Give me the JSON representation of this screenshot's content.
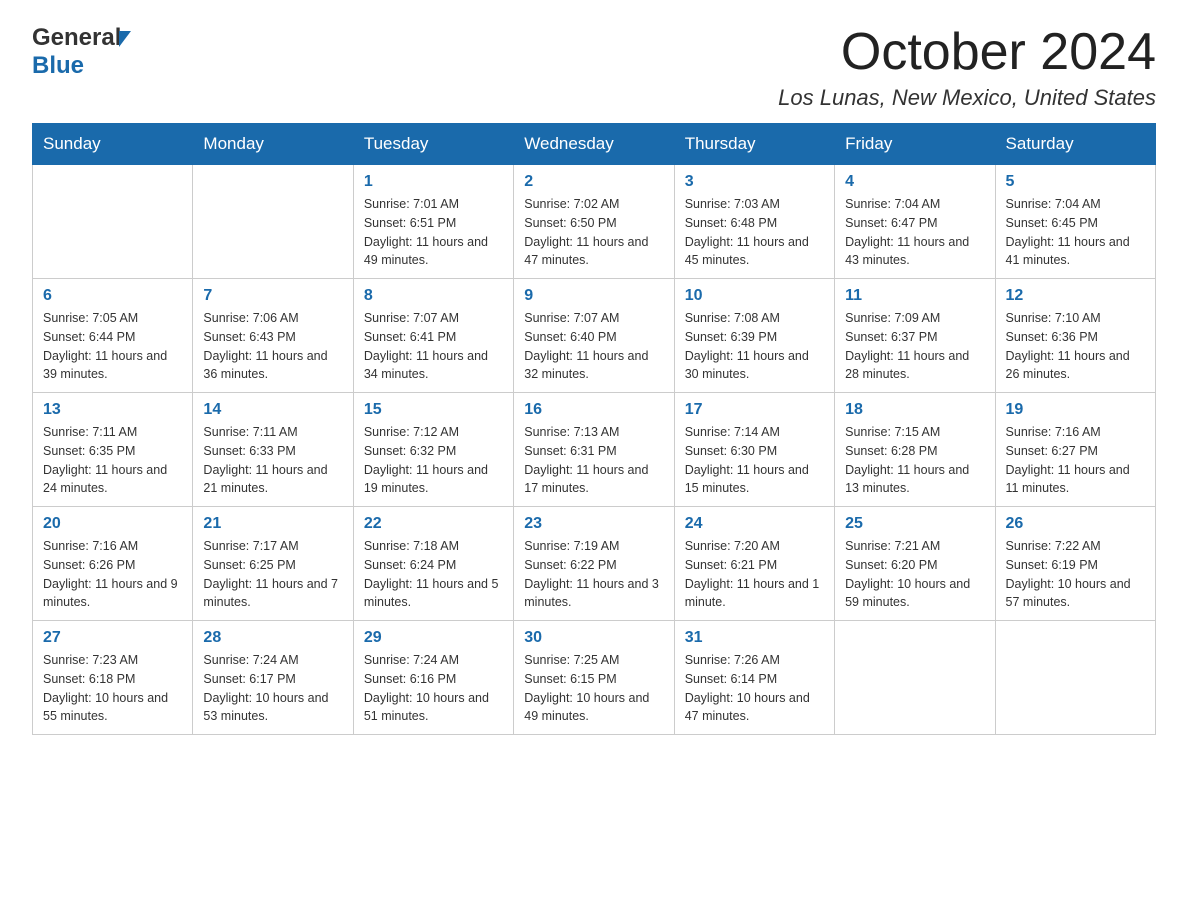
{
  "logo": {
    "general": "General",
    "triangle": "▶",
    "blue": "Blue"
  },
  "header": {
    "month": "October 2024",
    "location": "Los Lunas, New Mexico, United States"
  },
  "days_of_week": [
    "Sunday",
    "Monday",
    "Tuesday",
    "Wednesday",
    "Thursday",
    "Friday",
    "Saturday"
  ],
  "weeks": [
    [
      {
        "day": "",
        "info": ""
      },
      {
        "day": "",
        "info": ""
      },
      {
        "day": "1",
        "info": "Sunrise: 7:01 AM\nSunset: 6:51 PM\nDaylight: 11 hours\nand 49 minutes."
      },
      {
        "day": "2",
        "info": "Sunrise: 7:02 AM\nSunset: 6:50 PM\nDaylight: 11 hours\nand 47 minutes."
      },
      {
        "day": "3",
        "info": "Sunrise: 7:03 AM\nSunset: 6:48 PM\nDaylight: 11 hours\nand 45 minutes."
      },
      {
        "day": "4",
        "info": "Sunrise: 7:04 AM\nSunset: 6:47 PM\nDaylight: 11 hours\nand 43 minutes."
      },
      {
        "day": "5",
        "info": "Sunrise: 7:04 AM\nSunset: 6:45 PM\nDaylight: 11 hours\nand 41 minutes."
      }
    ],
    [
      {
        "day": "6",
        "info": "Sunrise: 7:05 AM\nSunset: 6:44 PM\nDaylight: 11 hours\nand 39 minutes."
      },
      {
        "day": "7",
        "info": "Sunrise: 7:06 AM\nSunset: 6:43 PM\nDaylight: 11 hours\nand 36 minutes."
      },
      {
        "day": "8",
        "info": "Sunrise: 7:07 AM\nSunset: 6:41 PM\nDaylight: 11 hours\nand 34 minutes."
      },
      {
        "day": "9",
        "info": "Sunrise: 7:07 AM\nSunset: 6:40 PM\nDaylight: 11 hours\nand 32 minutes."
      },
      {
        "day": "10",
        "info": "Sunrise: 7:08 AM\nSunset: 6:39 PM\nDaylight: 11 hours\nand 30 minutes."
      },
      {
        "day": "11",
        "info": "Sunrise: 7:09 AM\nSunset: 6:37 PM\nDaylight: 11 hours\nand 28 minutes."
      },
      {
        "day": "12",
        "info": "Sunrise: 7:10 AM\nSunset: 6:36 PM\nDaylight: 11 hours\nand 26 minutes."
      }
    ],
    [
      {
        "day": "13",
        "info": "Sunrise: 7:11 AM\nSunset: 6:35 PM\nDaylight: 11 hours\nand 24 minutes."
      },
      {
        "day": "14",
        "info": "Sunrise: 7:11 AM\nSunset: 6:33 PM\nDaylight: 11 hours\nand 21 minutes."
      },
      {
        "day": "15",
        "info": "Sunrise: 7:12 AM\nSunset: 6:32 PM\nDaylight: 11 hours\nand 19 minutes."
      },
      {
        "day": "16",
        "info": "Sunrise: 7:13 AM\nSunset: 6:31 PM\nDaylight: 11 hours\nand 17 minutes."
      },
      {
        "day": "17",
        "info": "Sunrise: 7:14 AM\nSunset: 6:30 PM\nDaylight: 11 hours\nand 15 minutes."
      },
      {
        "day": "18",
        "info": "Sunrise: 7:15 AM\nSunset: 6:28 PM\nDaylight: 11 hours\nand 13 minutes."
      },
      {
        "day": "19",
        "info": "Sunrise: 7:16 AM\nSunset: 6:27 PM\nDaylight: 11 hours\nand 11 minutes."
      }
    ],
    [
      {
        "day": "20",
        "info": "Sunrise: 7:16 AM\nSunset: 6:26 PM\nDaylight: 11 hours\nand 9 minutes."
      },
      {
        "day": "21",
        "info": "Sunrise: 7:17 AM\nSunset: 6:25 PM\nDaylight: 11 hours\nand 7 minutes."
      },
      {
        "day": "22",
        "info": "Sunrise: 7:18 AM\nSunset: 6:24 PM\nDaylight: 11 hours\nand 5 minutes."
      },
      {
        "day": "23",
        "info": "Sunrise: 7:19 AM\nSunset: 6:22 PM\nDaylight: 11 hours\nand 3 minutes."
      },
      {
        "day": "24",
        "info": "Sunrise: 7:20 AM\nSunset: 6:21 PM\nDaylight: 11 hours\nand 1 minute."
      },
      {
        "day": "25",
        "info": "Sunrise: 7:21 AM\nSunset: 6:20 PM\nDaylight: 10 hours\nand 59 minutes."
      },
      {
        "day": "26",
        "info": "Sunrise: 7:22 AM\nSunset: 6:19 PM\nDaylight: 10 hours\nand 57 minutes."
      }
    ],
    [
      {
        "day": "27",
        "info": "Sunrise: 7:23 AM\nSunset: 6:18 PM\nDaylight: 10 hours\nand 55 minutes."
      },
      {
        "day": "28",
        "info": "Sunrise: 7:24 AM\nSunset: 6:17 PM\nDaylight: 10 hours\nand 53 minutes."
      },
      {
        "day": "29",
        "info": "Sunrise: 7:24 AM\nSunset: 6:16 PM\nDaylight: 10 hours\nand 51 minutes."
      },
      {
        "day": "30",
        "info": "Sunrise: 7:25 AM\nSunset: 6:15 PM\nDaylight: 10 hours\nand 49 minutes."
      },
      {
        "day": "31",
        "info": "Sunrise: 7:26 AM\nSunset: 6:14 PM\nDaylight: 10 hours\nand 47 minutes."
      },
      {
        "day": "",
        "info": ""
      },
      {
        "day": "",
        "info": ""
      }
    ]
  ]
}
